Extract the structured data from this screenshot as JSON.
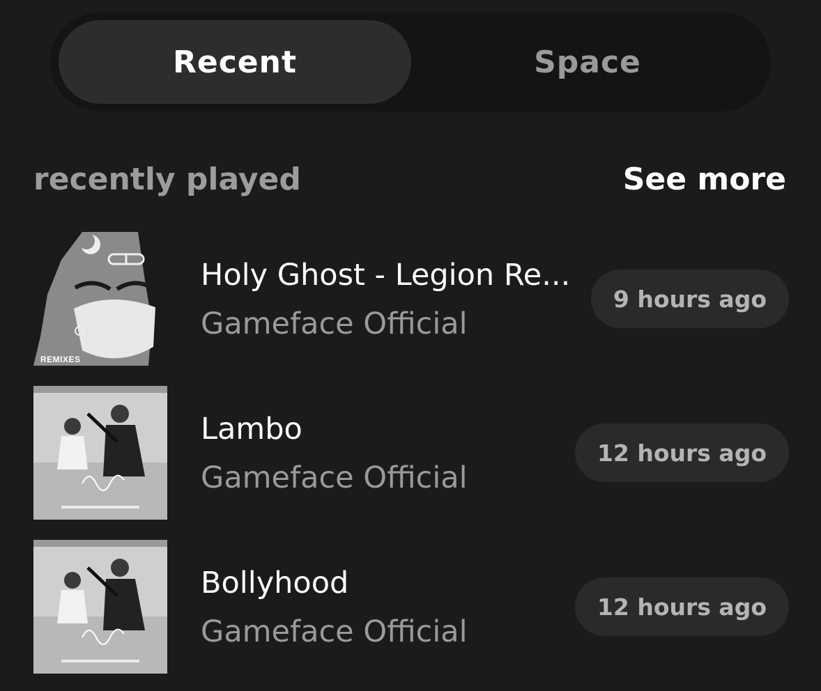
{
  "tabs": [
    {
      "label": "Recent",
      "active": true
    },
    {
      "label": "Space",
      "active": false
    }
  ],
  "section": {
    "title": "recently played",
    "see_more": "See more"
  },
  "tracks": [
    {
      "title": "Holy Ghost - Legion Re...",
      "artist": "Gameface Official",
      "time": "9 hours ago",
      "art_caption": "REMIXES"
    },
    {
      "title": "Lambo",
      "artist": "Gameface Official",
      "time": "12 hours ago"
    },
    {
      "title": "Bollyhood",
      "artist": "Gameface Official",
      "time": "12 hours ago"
    }
  ],
  "colors": {
    "background": "#1b1b1c",
    "tab_bar": "#141414",
    "tab_active": "#2d2d2e",
    "pill": "#2a2a2b",
    "secondary_text": "#9a9a9a"
  }
}
